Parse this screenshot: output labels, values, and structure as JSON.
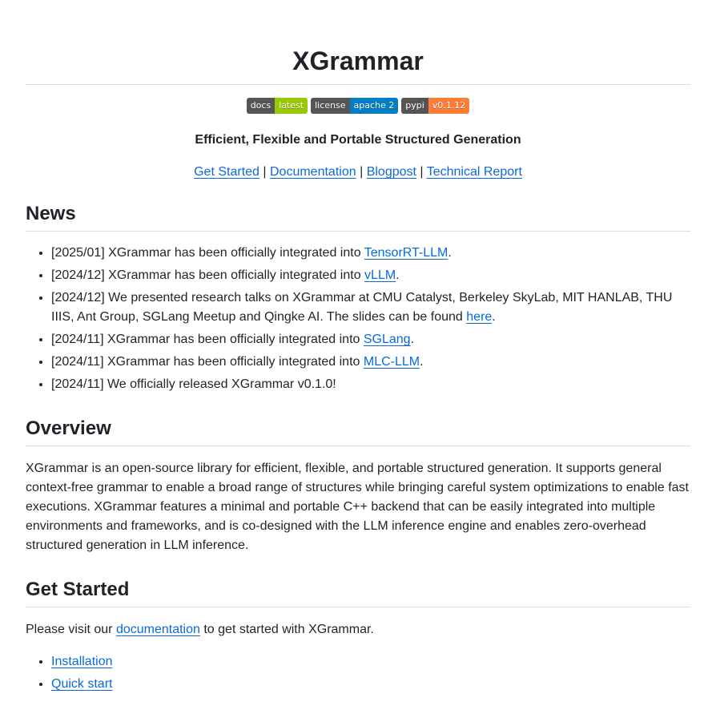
{
  "title": "XGrammar",
  "badges": [
    {
      "label": "docs",
      "value": "latest",
      "color": "#97ca00"
    },
    {
      "label": "license",
      "value": "apache 2",
      "color": "#007ec6"
    },
    {
      "label": "pypi",
      "value": "v0.1.12",
      "color": "#fe7d37"
    }
  ],
  "tagline": "Efficient, Flexible and Portable Structured Generation",
  "nav_links": [
    {
      "label": "Get Started"
    },
    {
      "label": "Documentation"
    },
    {
      "label": "Blogpost"
    },
    {
      "label": "Technical Report"
    }
  ],
  "nav_separator": "|",
  "news": {
    "heading": "News",
    "items": [
      {
        "prefix": "[2025/01] XGrammar has been officially integrated into ",
        "link": "TensorRT-LLM",
        "suffix": "."
      },
      {
        "prefix": "[2024/12] XGrammar has been officially integrated into ",
        "link": "vLLM",
        "suffix": "."
      },
      {
        "prefix": "[2024/12] We presented research talks on XGrammar at CMU Catalyst, Berkeley SkyLab, MIT HANLAB, THU IIIS, Ant Group, SGLang Meetup and Qingke AI. The slides can be found ",
        "link": "here",
        "suffix": "."
      },
      {
        "prefix": "[2024/11] XGrammar has been officially integrated into ",
        "link": "SGLang",
        "suffix": "."
      },
      {
        "prefix": "[2024/11] XGrammar has been officially integrated into ",
        "link": "MLC-LLM",
        "suffix": "."
      },
      {
        "prefix": "[2024/11] We officially released XGrammar v0.1.0!",
        "link": null,
        "suffix": ""
      }
    ]
  },
  "overview": {
    "heading": "Overview",
    "body": "XGrammar is an open-source library for efficient, flexible, and portable structured generation. It supports general context-free grammar to enable a broad range of structures while bringing careful system optimizations to enable fast executions. XGrammar features a minimal and portable C++ backend that can be easily integrated into multiple environments and frameworks, and is co-designed with the LLM inference engine and enables zero-overhead structured generation in LLM inference."
  },
  "get_started": {
    "heading": "Get Started",
    "text_before": "Please visit our ",
    "link": "documentation",
    "text_after": " to get started with XGrammar.",
    "items": [
      {
        "label": "Installation"
      },
      {
        "label": "Quick start"
      }
    ]
  }
}
